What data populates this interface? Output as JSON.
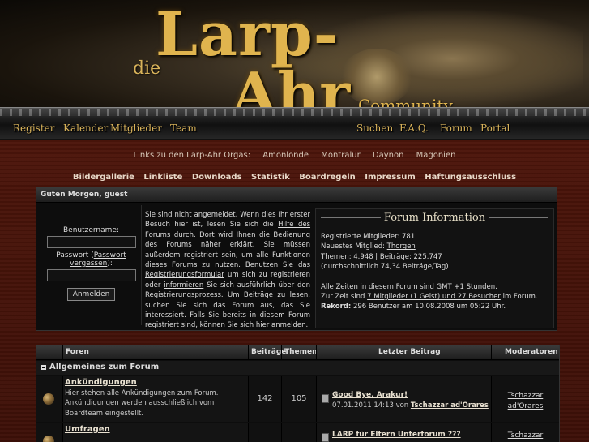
{
  "header": {
    "logo_die": "die",
    "logo_larp": "Larp-",
    "logo_ahr": "Ahr",
    "logo_community": "Community"
  },
  "nav": [
    {
      "label": "Register"
    },
    {
      "label": "Kalender"
    },
    {
      "label": "Mitglieder"
    },
    {
      "label": "Team"
    },
    {
      "label": "Suchen"
    },
    {
      "label": "F.A.Q."
    },
    {
      "label": "Forum"
    },
    {
      "label": "Portal"
    }
  ],
  "links_line": {
    "prefix": "Links zu den Larp-Ahr Orgas:",
    "items": [
      "Amonlonde",
      "Montralur",
      "Daynon",
      "Magonien"
    ]
  },
  "menu_line": [
    "Bildergallerie",
    "Linkliste",
    "Downloads",
    "Statistik",
    "Boardregeln",
    "Impressum",
    "Haftungsausschluss"
  ],
  "welcome": {
    "greeting": "Guten Morgen, guest",
    "username_label": "Benutzername:",
    "password_label": "Passwort (",
    "password_link": "Passwort vergessen",
    "password_suffix": "):",
    "login_button": "Anmelden",
    "text_1": "Sie sind nicht angemeldet. Wenn dies Ihr erster Besuch hier ist, lesen Sie sich die ",
    "link_help": "Hilfe des Forums",
    "text_2": " durch. Dort wird Ihnen die Bedienung des Forums näher erklärt. Sie müssen außerdem registriert sein, um alle Funktionen dieses Forums zu nutzen. Benutzen Sie das ",
    "link_form": "Registrierungsformular",
    "text_3": " um sich zu registrieren oder ",
    "link_info": "informieren",
    "text_4": " Sie sich ausführlich über den Registrierungsprozess. Um Beiträge zu lesen, suchen Sie sich das Forum aus, das Sie interessiert. Falls Sie bereits in diesem Forum registriert sind, können Sie sich ",
    "link_here": "hier",
    "text_5": " anmelden."
  },
  "info": {
    "title": "Forum Information",
    "members": "Registrierte Mitglieder: 781",
    "newest_prefix": "Neuestes Mitglied: ",
    "newest_name": "Thorgen",
    "threads": "Themen: 4.948 | Beiträge: 225.747",
    "avg": "(durchschnittlich 74,34 Beiträge/Tag)",
    "timezone": "Alle Zeiten in diesem Forum sind GMT +1 Stunden.",
    "online_prefix": "Zur Zeit sind ",
    "online_link": "7 Mitglieder (1 Geist) und 27 Besucher",
    "online_suffix": " im Forum.",
    "record_label": "Rekord:",
    "record_text": " 296 Benutzer am 10.08.2008 um 05:22 Uhr."
  },
  "forum_table": {
    "headers": {
      "forum": "Foren",
      "posts": "Beiträge",
      "threads": "Themen",
      "last": "Letzter Beitrag",
      "mods": "Moderatoren"
    },
    "category": "Allgemeines zum Forum",
    "rows": [
      {
        "title": "Ankündigungen",
        "desc": "Hier stehen alle Ankündigungen zum Forum. Ankündigungen werden ausschließlich vom Boardteam eingestellt.",
        "posts": "142",
        "threads": "105",
        "last_title": "Good Bye, Arakur!",
        "last_meta": "07.01.2011 14:13 von ",
        "last_user": "Tschazzar ad'Orares",
        "mod_1": "Tschazzar",
        "mod_2": "ad'Orares"
      },
      {
        "title": "Umfragen",
        "desc": "",
        "posts": "",
        "threads": "",
        "last_title": "LARP für Eltern Unterforum ???",
        "last_meta": "",
        "last_user": "",
        "mod_1": "Tschazzar",
        "mod_2": ""
      }
    ]
  }
}
